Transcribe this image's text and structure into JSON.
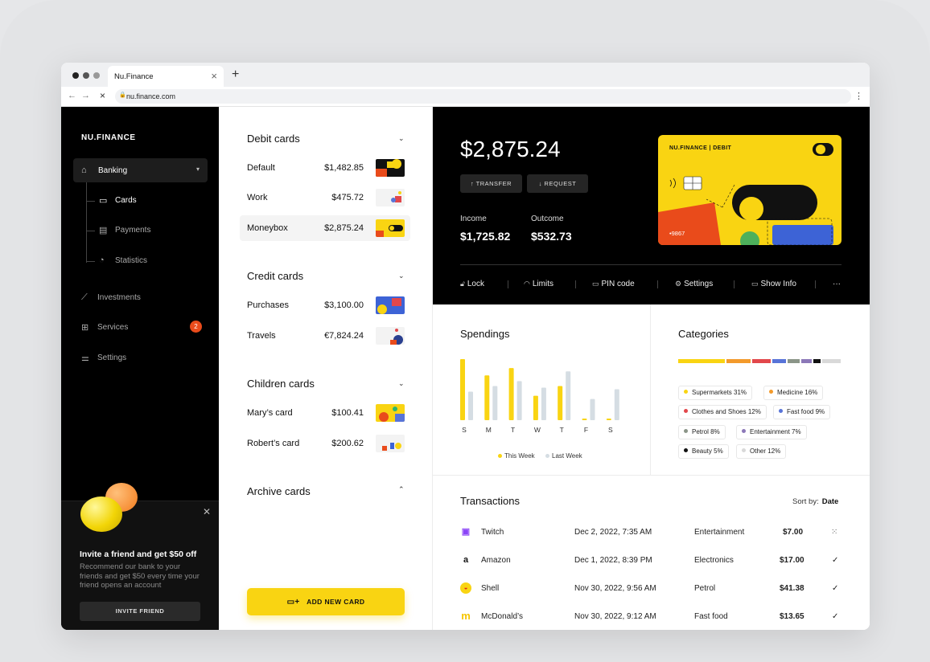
{
  "browser": {
    "tab_title": "Nu.Finance",
    "url": "nu.finance.com"
  },
  "sidebar": {
    "logo": "NU.FINANCE",
    "banking_label": "Banking",
    "sub_items": [
      {
        "label": "Cards",
        "icon": "card-icon"
      },
      {
        "label": "Payments",
        "icon": "document-icon"
      },
      {
        "label": "Statistics",
        "icon": "pie-chart-icon"
      }
    ],
    "items": [
      {
        "label": "Investments",
        "icon": "chart-line-icon"
      },
      {
        "label": "Services",
        "icon": "grid-icon",
        "badge": "2"
      },
      {
        "label": "Settings",
        "icon": "sliders-icon"
      }
    ],
    "invite": {
      "title": "Invite a friend and get $50 off",
      "text": "Recommend our bank to your friends and get $50 every time your friend opens an account",
      "button": "INVITE FRIEND"
    }
  },
  "card_groups": [
    {
      "title": "Debit cards",
      "expanded": true,
      "cards": [
        {
          "name": "Default",
          "amount": "$1,482.85"
        },
        {
          "name": "Work",
          "amount": "$475.72"
        },
        {
          "name": "Moneybox",
          "amount": "$2,875.24",
          "selected": true
        }
      ]
    },
    {
      "title": "Credit cards",
      "expanded": true,
      "cards": [
        {
          "name": "Purchases",
          "amount": "$3,100.00"
        },
        {
          "name": "Travels",
          "amount": "€7,824.24"
        }
      ]
    },
    {
      "title": "Children cards",
      "expanded": true,
      "cards": [
        {
          "name": "Mary’s card",
          "amount": "$100.41"
        },
        {
          "name": "Robert’s card",
          "amount": "$200.62"
        }
      ]
    },
    {
      "title": "Archive cards",
      "expanded": false,
      "cards": []
    }
  ],
  "add_card_label": "ADD NEW CARD",
  "hero": {
    "balance": "$2,875.24",
    "transfer_label": "↑ TRANSFER",
    "request_label": "↓ REQUEST",
    "income_label": "Income",
    "income_value": "$1,725.82",
    "outcome_label": "Outcome",
    "outcome_value": "$532.73",
    "card_brand": "NU.FINANCE | DEBIT",
    "card_number": "•9867",
    "actions": [
      {
        "label": "Lock",
        "icon": "lock-icon"
      },
      {
        "label": "Limits",
        "icon": "gauge-icon"
      },
      {
        "label": "PIN code",
        "icon": "key-icon"
      },
      {
        "label": "Settings",
        "icon": "gear-icon"
      },
      {
        "label": "Show Info",
        "icon": "card-icon"
      }
    ],
    "more_label": "···"
  },
  "spendings": {
    "title": "Spendings",
    "legend_this": "This Week",
    "legend_last": "Last Week",
    "colors": {
      "this_week": "#f9d412",
      "last_week": "#d5dde3"
    }
  },
  "chart_data": {
    "type": "bar",
    "categories": [
      "S",
      "M",
      "T",
      "W",
      "T",
      "F",
      "S"
    ],
    "series": [
      {
        "name": "This Week",
        "values": [
          75,
          55,
          64,
          30,
          42,
          2,
          2
        ]
      },
      {
        "name": "Last Week",
        "values": [
          35,
          42,
          48,
          40,
          60,
          26,
          38
        ]
      }
    ],
    "title": "Spendings",
    "legend": "bottom"
  },
  "categories": {
    "title": "Categories",
    "bar_segments": [
      {
        "color": "#f9d412",
        "share": 31
      },
      {
        "color": "#f39a2b",
        "share": 16
      },
      {
        "color": "#e2474b",
        "share": 12
      },
      {
        "color": "#5874d8",
        "share": 9
      },
      {
        "color": "#8b9588",
        "share": 8
      },
      {
        "color": "#8c78b8",
        "share": 7
      },
      {
        "color": "#111111",
        "share": 5
      },
      {
        "color": "#d9d9d9",
        "share": 12
      }
    ],
    "items": [
      {
        "label": "Supermarkets",
        "pct": "31%",
        "color": "#f9d412"
      },
      {
        "label": "Medicine",
        "pct": "16%",
        "color": "#f39a2b"
      },
      {
        "label": "Clothes and Shoes",
        "pct": "12%",
        "color": "#e2474b"
      },
      {
        "label": "Fast food",
        "pct": "9%",
        "color": "#5874d8"
      },
      {
        "label": "Petrol",
        "pct": "8%",
        "color": "#8b9588"
      },
      {
        "label": "Entertainment",
        "pct": "7%",
        "color": "#8c78b8"
      },
      {
        "label": "Beauty",
        "pct": "5%",
        "color": "#111111"
      },
      {
        "label": "Other",
        "pct": "12%",
        "color": "#d9d9d9"
      }
    ]
  },
  "transactions": {
    "title": "Transactions",
    "sort_label": "Sort by:",
    "sort_value": "Date",
    "rows": [
      {
        "merchant": "Twitch",
        "date": "Dec 2, 2022, 7:35 AM",
        "category": "Entertainment",
        "amount": "$7.00",
        "status": "pending",
        "status_icon": "spinner-icon"
      },
      {
        "merchant": "Amazon",
        "date": "Dec 1, 2022, 8:39 PM",
        "category": "Electronics",
        "amount": "$17.00",
        "status": "done",
        "status_icon": "check-icon"
      },
      {
        "merchant": "Shell",
        "date": "Nov 30, 2022, 9:56 AM",
        "category": "Petrol",
        "amount": "$41.38",
        "status": "done",
        "status_icon": "check-icon"
      },
      {
        "merchant": "McDonald’s",
        "date": "Nov 30, 2022, 9:12 AM",
        "category": "Fast food",
        "amount": "$13.65",
        "status": "done",
        "status_icon": "check-icon"
      }
    ]
  }
}
